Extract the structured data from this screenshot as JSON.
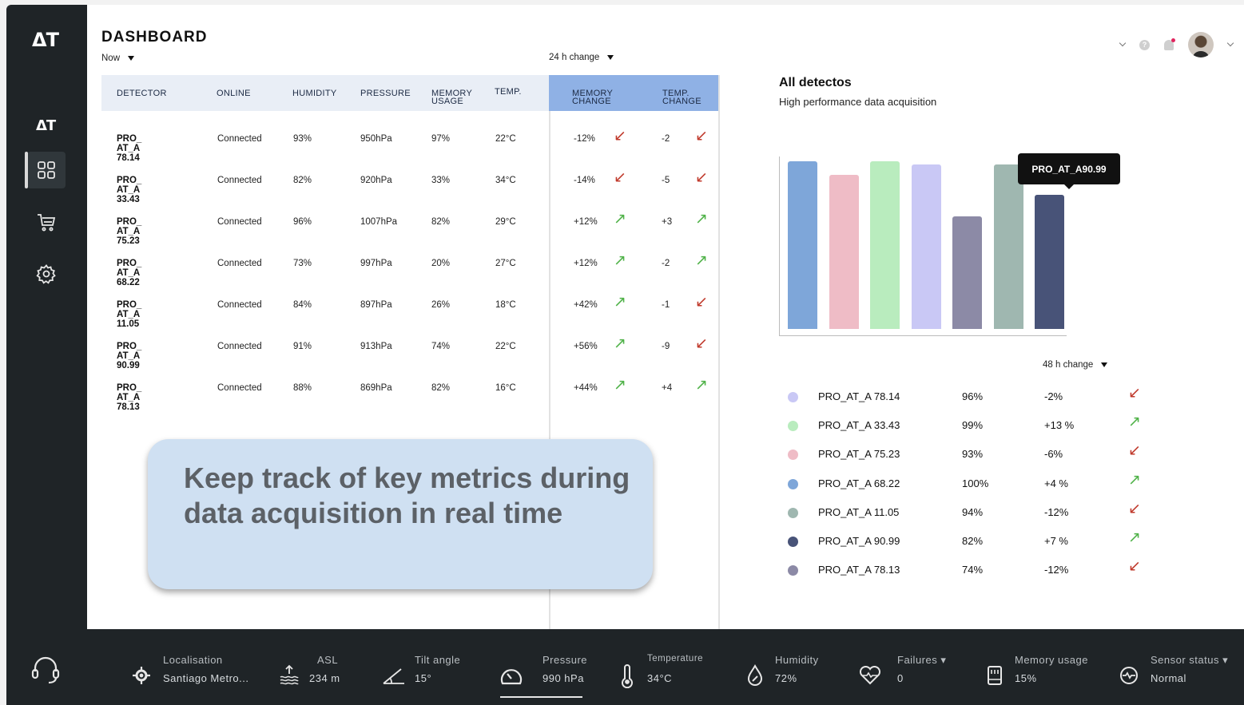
{
  "app": {
    "logo": "ΔT",
    "logo_small": "ΔT"
  },
  "header": {
    "title": "DASHBOARD",
    "time_filter": "Now",
    "change_filter": "24 h change"
  },
  "table": {
    "columns": [
      "DETECTOR",
      "ONLINE",
      "HUMIDITY",
      "PRESSURE",
      "MEMORY",
      "USAGE",
      "TEMP."
    ],
    "change_columns": [
      "MEMORY",
      "CHANGE",
      "TEMP.",
      "CHANGE"
    ],
    "rows": [
      {
        "detector": "PRO_ AT_A 78.14",
        "online": "Connected",
        "humidity": "93%",
        "pressure": "950hPa",
        "memory": "97%",
        "temp": "22°C",
        "mem_change": "-12%",
        "mem_dir": "down",
        "temp_change": "-2",
        "temp_dir": "down"
      },
      {
        "detector": "PRO_ AT_A 33.43",
        "online": "Connected",
        "humidity": "82%",
        "pressure": "920hPa",
        "memory": "33%",
        "temp": "34°C",
        "mem_change": "-14%",
        "mem_dir": "down",
        "temp_change": "-5",
        "temp_dir": "down"
      },
      {
        "detector": "PRO_ AT_A 75.23",
        "online": "Connected",
        "humidity": "96%",
        "pressure": "1007hPa",
        "memory": "82%",
        "temp": "29°C",
        "mem_change": "+12%",
        "mem_dir": "up",
        "temp_change": "+3",
        "temp_dir": "up"
      },
      {
        "detector": "PRO_ AT_A 68.22",
        "online": "Connected",
        "humidity": "73%",
        "pressure": "997hPa",
        "memory": "20%",
        "temp": "27°C",
        "mem_change": "+12%",
        "mem_dir": "up",
        "temp_change": "-2",
        "temp_dir": "up"
      },
      {
        "detector": "PRO_ AT_A 11.05",
        "online": "Connected",
        "humidity": "84%",
        "pressure": "897hPa",
        "memory": "26%",
        "temp": "18°C",
        "mem_change": "+42%",
        "mem_dir": "up",
        "temp_change": "-1",
        "temp_dir": "down"
      },
      {
        "detector": "PRO_ AT_A 90.99",
        "online": "Connected",
        "humidity": "91%",
        "pressure": "913hPa",
        "memory": "74%",
        "temp": "22°C",
        "mem_change": "+56%",
        "mem_dir": "up",
        "temp_change": "-9",
        "temp_dir": "down"
      },
      {
        "detector": "PRO_ AT_A 78.13",
        "online": "Connected",
        "humidity": "88%",
        "pressure": "869hPa",
        "memory": "82%",
        "temp": "16°C",
        "mem_change": "+44%",
        "mem_dir": "up",
        "temp_change": "+4",
        "temp_dir": "up"
      }
    ]
  },
  "callout": {
    "text": "Keep track of key metrics during data acquisition in real time"
  },
  "chart": {
    "title": "All detectos",
    "subtitle": "High performance data acquisition",
    "tooltip": "PRO_AT_A90.99",
    "legend_filter": "48 h change"
  },
  "chart_data": {
    "type": "bar",
    "title": "All detectos",
    "subtitle": "High performance data acquisition",
    "values": [
      100,
      92,
      100,
      98,
      67,
      98,
      80
    ],
    "colors": [
      "#7ea6d9",
      "#efbcc6",
      "#b9ecbe",
      "#c9c8f5",
      "#8c8aa6",
      "#9fb7b0",
      "#485378"
    ],
    "ylim": [
      0,
      100
    ]
  },
  "legend": [
    {
      "name": "PRO_AT_A 78.14",
      "pct": "96%",
      "change": "-2%",
      "dir": "down",
      "color": "#c9c8f5"
    },
    {
      "name": "PRO_AT_A 33.43",
      "pct": "99%",
      "change": "+13 %",
      "dir": "up",
      "color": "#b9ecbe"
    },
    {
      "name": "PRO_AT_A 75.23",
      "pct": "93%",
      "change": "-6%",
      "dir": "down",
      "color": "#efbcc6"
    },
    {
      "name": "PRO_AT_A 68.22",
      "pct": "100%",
      "change": "+4 %",
      "dir": "up",
      "color": "#7ea6d9"
    },
    {
      "name": "PRO_AT_A 11.05",
      "pct": "94%",
      "change": "-12%",
      "dir": "down",
      "color": "#9fb7b0"
    },
    {
      "name": "PRO_AT_A 90.99",
      "pct": "82%",
      "change": "+7 %",
      "dir": "up",
      "color": "#485378"
    },
    {
      "name": "PRO_AT_A 78.13",
      "pct": "74%",
      "change": "-12%",
      "dir": "down",
      "color": "#8c8aa6"
    }
  ],
  "status_bar": {
    "localisation": {
      "label": "Localisation",
      "value": "Santiago Metro..."
    },
    "asl": {
      "label": "ASL",
      "value": "234 m"
    },
    "tilt": {
      "label": "Tilt angle",
      "value": "15°"
    },
    "pressure": {
      "label": "Pressure",
      "value": "990 hPa"
    },
    "temperature": {
      "label": "Temperature",
      "value": "34°C"
    },
    "humidity": {
      "label": "Humidity",
      "value": "72%"
    },
    "failures": {
      "label": "Failures ▾",
      "value": "0"
    },
    "memory": {
      "label": "Memory usage",
      "value": "15%"
    },
    "sensor": {
      "label": "Sensor status ▾",
      "value": "Normal"
    }
  },
  "icons": {
    "up": "↗",
    "down": "↙"
  }
}
